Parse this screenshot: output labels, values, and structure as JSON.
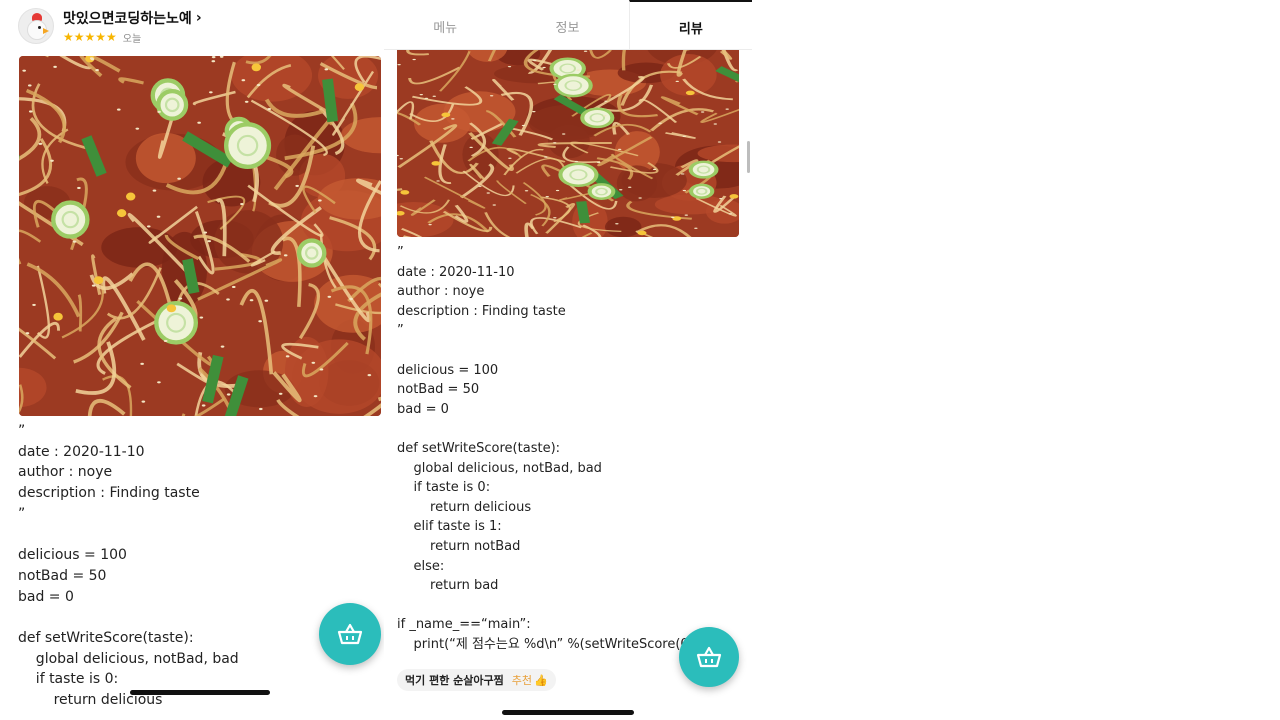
{
  "reviewer": {
    "name": "맛있으면코딩하는노예",
    "chevron": "›",
    "stars": "★★★★★",
    "date": "오늘",
    "rating": 5,
    "avatar_icon": "chicken-avatar-icon"
  },
  "tabs": [
    {
      "label": "메뉴",
      "active": false
    },
    {
      "label": "정보",
      "active": false
    },
    {
      "label": "리뷰",
      "active": true
    }
  ],
  "review_left": "”\ndate : 2020-11-10\nauthor : noye\ndescription : Finding taste\n”\n\ndelicious = 100\nnotBad = 50\nbad = 0\n\ndef setWriteScore(taste):\n    global delicious, notBad, bad\n    if taste is 0:\n        return delicious",
  "review_right": "”\ndate : 2020-11-10\nauthor : noye\ndescription : Finding taste\n”\n\ndelicious = 100\nnotBad = 50\nbad = 0\n\ndef setWriteScore(taste):\n    global delicious, notBad, bad\n    if taste is 0:\n        return delicious\n    elif taste is 1:\n        return notBad\n    else:\n        return bad\n\nif _name_==“main”:\n    print(“제 점수는요 %d\\n” %(setWriteScore(0)))",
  "menu_tag": {
    "menu": "먹기 편한 순살아구찜",
    "recommend": "추천",
    "thumb_icon": "thumbs-up-icon",
    "thumb_glyph": "👍"
  },
  "cart_icon": "shopping-basket-icon",
  "colors": {
    "accent": "#2bbdbb",
    "star": "#f7b500",
    "recommend": "#e8a03a"
  }
}
